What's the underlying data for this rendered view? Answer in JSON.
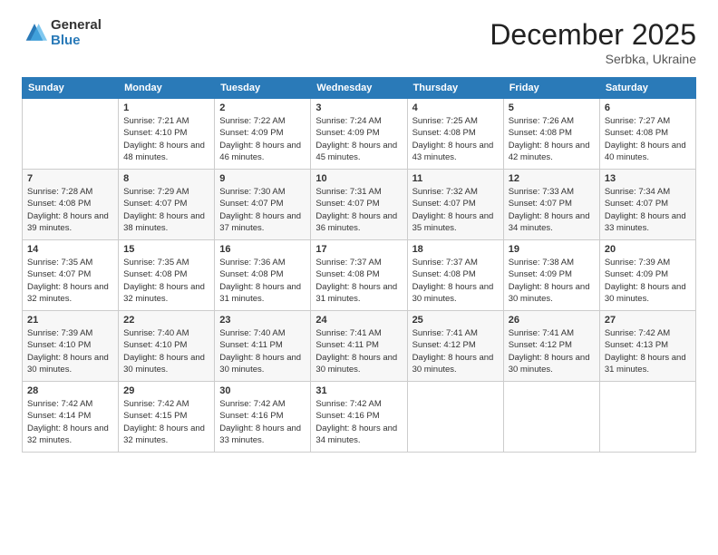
{
  "header": {
    "logo_general": "General",
    "logo_blue": "Blue",
    "month_title": "December 2025",
    "subtitle": "Serbka, Ukraine"
  },
  "days_of_week": [
    "Sunday",
    "Monday",
    "Tuesday",
    "Wednesday",
    "Thursday",
    "Friday",
    "Saturday"
  ],
  "weeks": [
    [
      {
        "day": "",
        "info": ""
      },
      {
        "day": "1",
        "info": "Sunrise: 7:21 AM\nSunset: 4:10 PM\nDaylight: 8 hours and 48 minutes."
      },
      {
        "day": "2",
        "info": "Sunrise: 7:22 AM\nSunset: 4:09 PM\nDaylight: 8 hours and 46 minutes."
      },
      {
        "day": "3",
        "info": "Sunrise: 7:24 AM\nSunset: 4:09 PM\nDaylight: 8 hours and 45 minutes."
      },
      {
        "day": "4",
        "info": "Sunrise: 7:25 AM\nSunset: 4:08 PM\nDaylight: 8 hours and 43 minutes."
      },
      {
        "day": "5",
        "info": "Sunrise: 7:26 AM\nSunset: 4:08 PM\nDaylight: 8 hours and 42 minutes."
      },
      {
        "day": "6",
        "info": "Sunrise: 7:27 AM\nSunset: 4:08 PM\nDaylight: 8 hours and 40 minutes."
      }
    ],
    [
      {
        "day": "7",
        "info": "Sunrise: 7:28 AM\nSunset: 4:08 PM\nDaylight: 8 hours and 39 minutes."
      },
      {
        "day": "8",
        "info": "Sunrise: 7:29 AM\nSunset: 4:07 PM\nDaylight: 8 hours and 38 minutes."
      },
      {
        "day": "9",
        "info": "Sunrise: 7:30 AM\nSunset: 4:07 PM\nDaylight: 8 hours and 37 minutes."
      },
      {
        "day": "10",
        "info": "Sunrise: 7:31 AM\nSunset: 4:07 PM\nDaylight: 8 hours and 36 minutes."
      },
      {
        "day": "11",
        "info": "Sunrise: 7:32 AM\nSunset: 4:07 PM\nDaylight: 8 hours and 35 minutes."
      },
      {
        "day": "12",
        "info": "Sunrise: 7:33 AM\nSunset: 4:07 PM\nDaylight: 8 hours and 34 minutes."
      },
      {
        "day": "13",
        "info": "Sunrise: 7:34 AM\nSunset: 4:07 PM\nDaylight: 8 hours and 33 minutes."
      }
    ],
    [
      {
        "day": "14",
        "info": "Sunrise: 7:35 AM\nSunset: 4:07 PM\nDaylight: 8 hours and 32 minutes."
      },
      {
        "day": "15",
        "info": "Sunrise: 7:35 AM\nSunset: 4:08 PM\nDaylight: 8 hours and 32 minutes."
      },
      {
        "day": "16",
        "info": "Sunrise: 7:36 AM\nSunset: 4:08 PM\nDaylight: 8 hours and 31 minutes."
      },
      {
        "day": "17",
        "info": "Sunrise: 7:37 AM\nSunset: 4:08 PM\nDaylight: 8 hours and 31 minutes."
      },
      {
        "day": "18",
        "info": "Sunrise: 7:37 AM\nSunset: 4:08 PM\nDaylight: 8 hours and 30 minutes."
      },
      {
        "day": "19",
        "info": "Sunrise: 7:38 AM\nSunset: 4:09 PM\nDaylight: 8 hours and 30 minutes."
      },
      {
        "day": "20",
        "info": "Sunrise: 7:39 AM\nSunset: 4:09 PM\nDaylight: 8 hours and 30 minutes."
      }
    ],
    [
      {
        "day": "21",
        "info": "Sunrise: 7:39 AM\nSunset: 4:10 PM\nDaylight: 8 hours and 30 minutes."
      },
      {
        "day": "22",
        "info": "Sunrise: 7:40 AM\nSunset: 4:10 PM\nDaylight: 8 hours and 30 minutes."
      },
      {
        "day": "23",
        "info": "Sunrise: 7:40 AM\nSunset: 4:11 PM\nDaylight: 8 hours and 30 minutes."
      },
      {
        "day": "24",
        "info": "Sunrise: 7:41 AM\nSunset: 4:11 PM\nDaylight: 8 hours and 30 minutes."
      },
      {
        "day": "25",
        "info": "Sunrise: 7:41 AM\nSunset: 4:12 PM\nDaylight: 8 hours and 30 minutes."
      },
      {
        "day": "26",
        "info": "Sunrise: 7:41 AM\nSunset: 4:12 PM\nDaylight: 8 hours and 30 minutes."
      },
      {
        "day": "27",
        "info": "Sunrise: 7:42 AM\nSunset: 4:13 PM\nDaylight: 8 hours and 31 minutes."
      }
    ],
    [
      {
        "day": "28",
        "info": "Sunrise: 7:42 AM\nSunset: 4:14 PM\nDaylight: 8 hours and 32 minutes."
      },
      {
        "day": "29",
        "info": "Sunrise: 7:42 AM\nSunset: 4:15 PM\nDaylight: 8 hours and 32 minutes."
      },
      {
        "day": "30",
        "info": "Sunrise: 7:42 AM\nSunset: 4:16 PM\nDaylight: 8 hours and 33 minutes."
      },
      {
        "day": "31",
        "info": "Sunrise: 7:42 AM\nSunset: 4:16 PM\nDaylight: 8 hours and 34 minutes."
      },
      {
        "day": "",
        "info": ""
      },
      {
        "day": "",
        "info": ""
      },
      {
        "day": "",
        "info": ""
      }
    ]
  ]
}
